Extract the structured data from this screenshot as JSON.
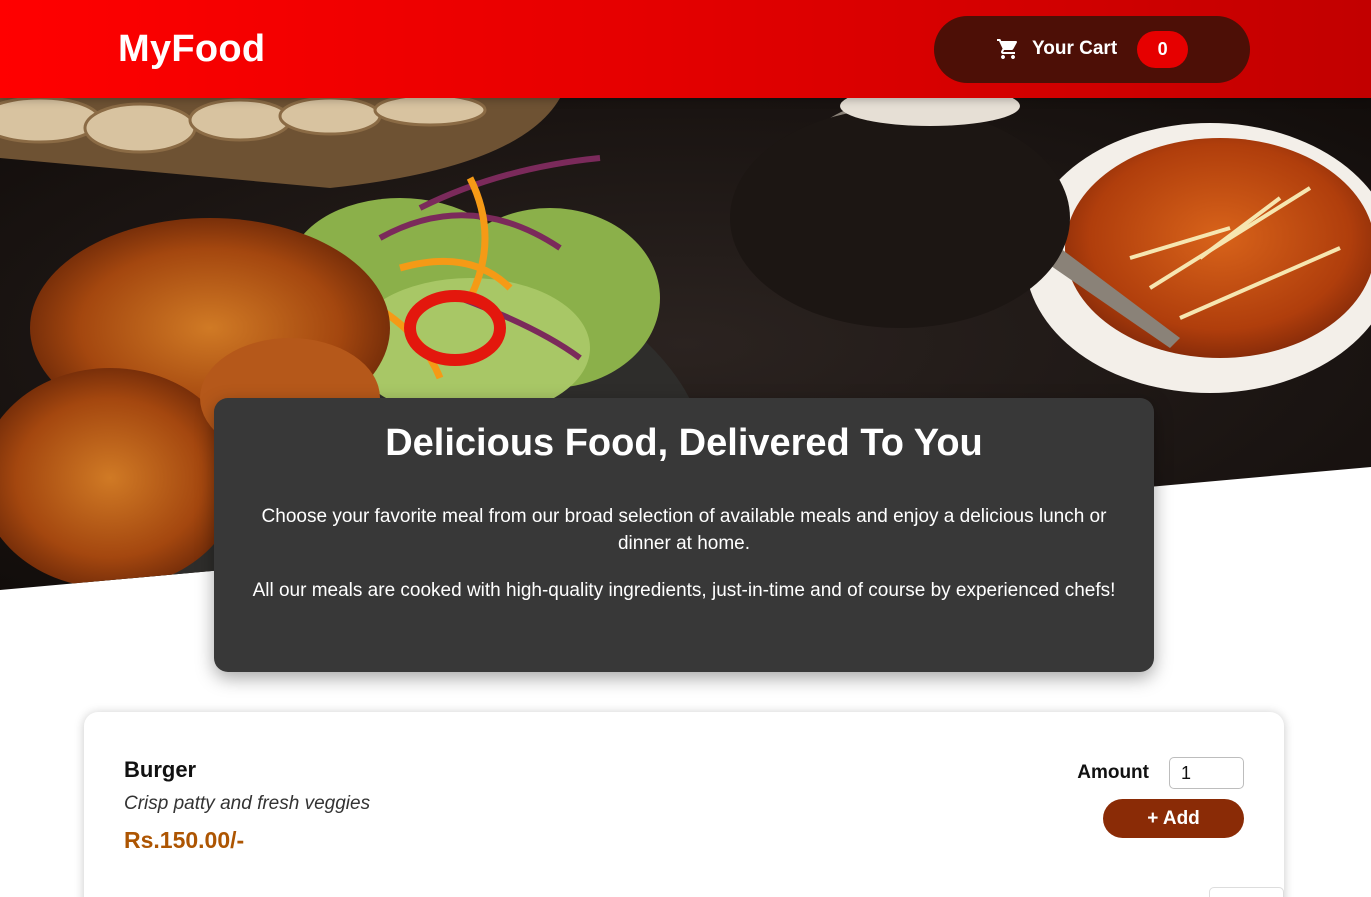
{
  "header": {
    "logo": "MyFood",
    "cart": {
      "label": "Your Cart",
      "count": "0",
      "icon": "cart-icon"
    }
  },
  "colors": {
    "header_start": "#ff0000",
    "header_end": "#c20000",
    "cart_button": "#4d0f06",
    "badge": "#e60000",
    "summary_bg": "#383838",
    "price": "#ad5502",
    "add_button": "#8a2b06"
  },
  "summary": {
    "title": "Delicious Food, Delivered To You",
    "paragraph1": "Choose your favorite meal from our broad selection of available meals and enjoy a delicious lunch or dinner at home.",
    "paragraph2": "All our meals are cooked with high-quality ingredients, just-in-time and of course by experienced chefs!"
  },
  "meals": [
    {
      "name": "Burger",
      "description": "Crisp patty and fresh veggies",
      "price": "Rs.150.00/-",
      "amount_label": "Amount",
      "amount_value": "1",
      "add_label": "+ Add"
    }
  ]
}
